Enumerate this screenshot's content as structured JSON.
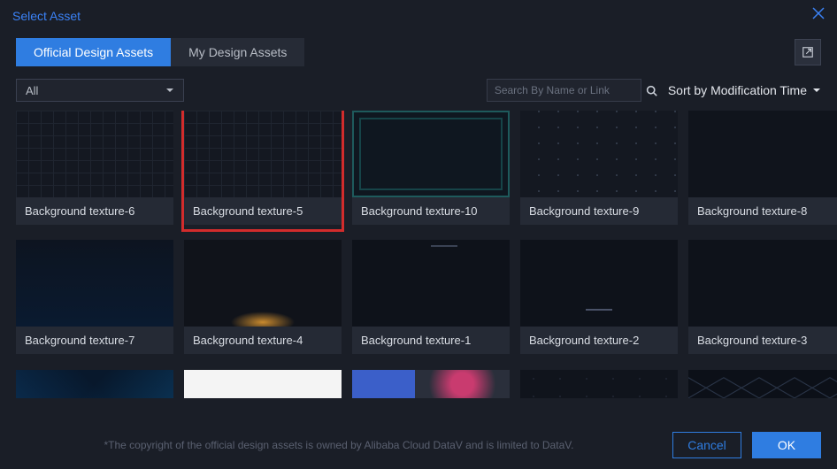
{
  "header": {
    "title": "Select Asset"
  },
  "tabs": [
    {
      "label": "Official Design Assets",
      "active": true
    },
    {
      "label": "My Design Assets",
      "active": false
    }
  ],
  "filter": {
    "selected": "All"
  },
  "search": {
    "placeholder": "Search By Name or Link"
  },
  "sort": {
    "label": "Sort by Modification Time"
  },
  "assets": [
    {
      "name": "Background texture-6",
      "selected": false,
      "variant": "tex-grid"
    },
    {
      "name": "Background texture-5",
      "selected": true,
      "variant": "tex-grid"
    },
    {
      "name": "Background texture-10",
      "selected": false,
      "variant": "tex-frame"
    },
    {
      "name": "Background texture-9",
      "selected": false,
      "variant": "tex-dots"
    },
    {
      "name": "Background texture-8",
      "selected": false,
      "variant": "tex-dark"
    },
    {
      "name": "Background texture-7",
      "selected": false,
      "variant": "tex-gradient"
    },
    {
      "name": "Background texture-4",
      "selected": false,
      "variant": "tex-glow"
    },
    {
      "name": "Background texture-1",
      "selected": false,
      "variant": "tex-lines"
    },
    {
      "name": "Background texture-2",
      "selected": false,
      "variant": "tex-bar"
    },
    {
      "name": "Background texture-3",
      "selected": false,
      "variant": "tex-plain"
    }
  ],
  "assets_partial": [
    {
      "variant": "tex-tech"
    },
    {
      "variant": "tex-white"
    },
    {
      "variant": "tex-colorful"
    },
    {
      "variant": "tex-dots2"
    },
    {
      "variant": "tex-net"
    }
  ],
  "footer": {
    "copyright": "*The copyright of the official design assets is owned by Alibaba Cloud DataV and is limited to DataV.",
    "cancel": "Cancel",
    "ok": "OK"
  }
}
